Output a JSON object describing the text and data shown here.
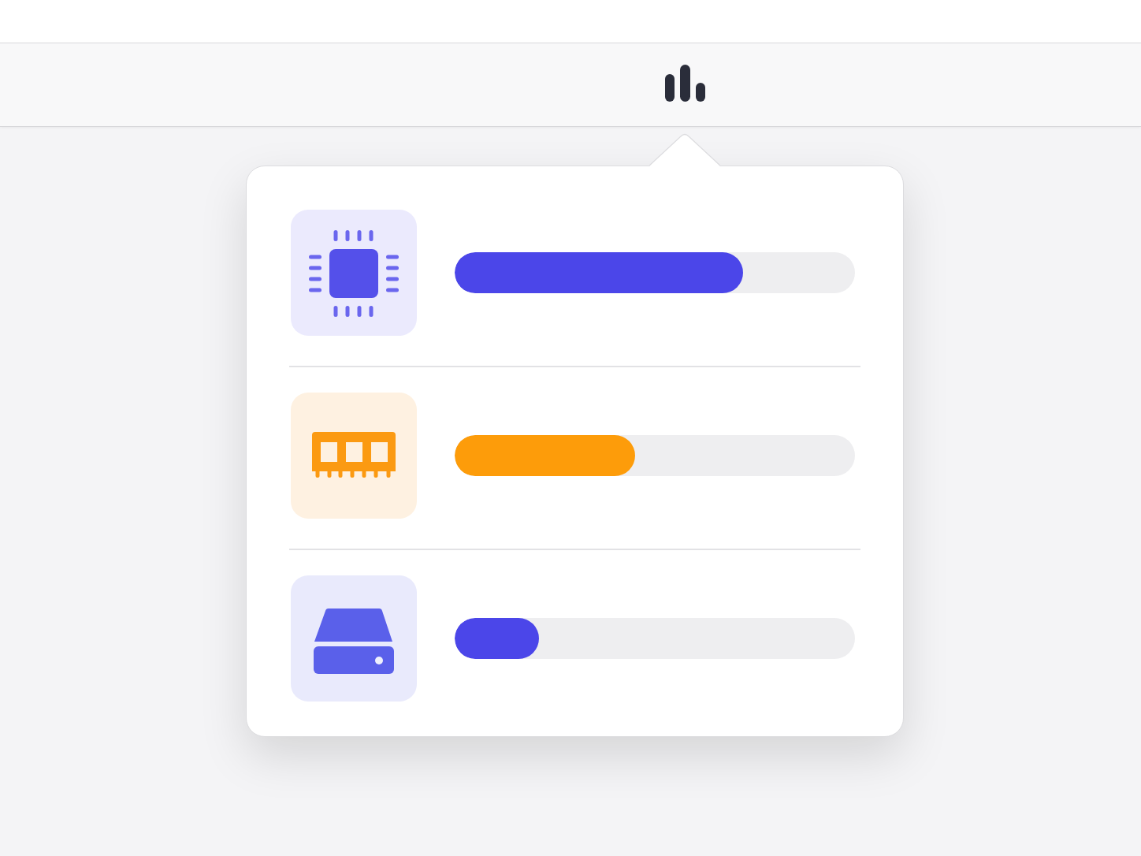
{
  "meters": [
    {
      "kind": "cpu",
      "level": 0.72,
      "color": "#4b46e9"
    },
    {
      "kind": "memory",
      "level": 0.45,
      "color": "#fd9c0a"
    },
    {
      "kind": "disk",
      "level": 0.21,
      "color": "#4b46e9"
    }
  ]
}
